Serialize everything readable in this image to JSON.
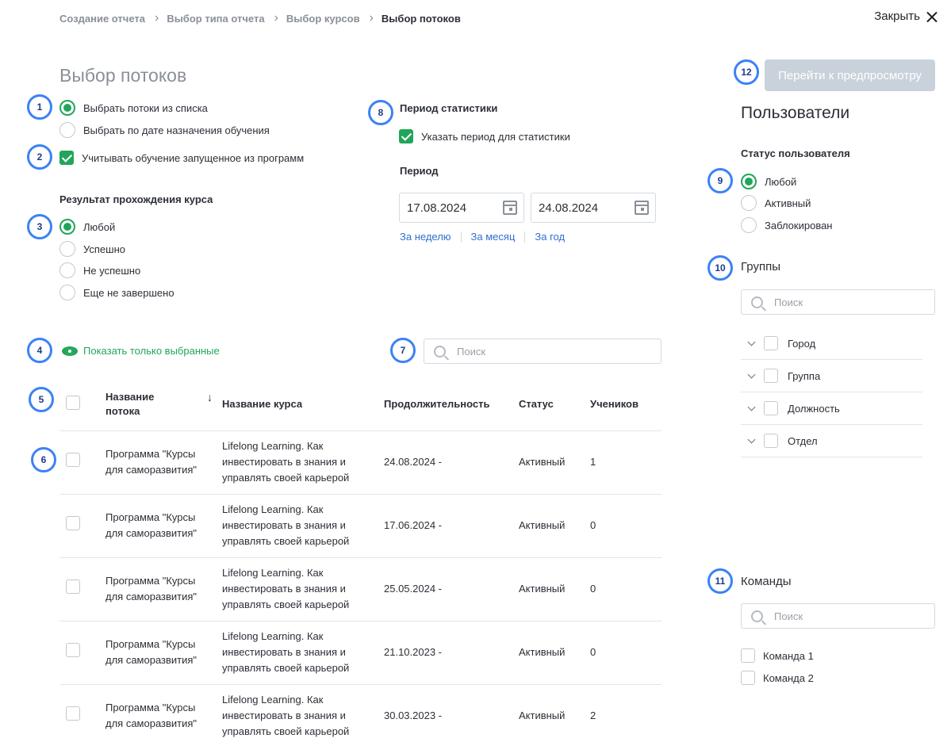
{
  "breadcrumb": {
    "items": [
      "Создание отчета",
      "Выбор типа отчета",
      "Выбор курсов"
    ],
    "current": "Выбор потоков"
  },
  "close_label": "Закрыть",
  "page_title": "Выбор потоков",
  "markers": [
    "1",
    "2",
    "3",
    "4",
    "5",
    "6",
    "7",
    "8",
    "9",
    "10",
    "11",
    "12"
  ],
  "selection_mode": {
    "options": [
      "Выбрать потоки из списка",
      "Выбрать по дате назначения обучения"
    ],
    "selected": 0
  },
  "include_programs": {
    "label": "Учитывать обучение запущенное из программ",
    "checked": true
  },
  "course_result": {
    "label": "Результат прохождения курса",
    "options": [
      "Любой",
      "Успешно",
      "Не успешно",
      "Еще не завершено"
    ],
    "selected": 0
  },
  "stats_period": {
    "label": "Период статистики",
    "toggle_label": "Указать период для статистики",
    "toggle_checked": true,
    "period_label": "Период",
    "date_from": "17.08.2024",
    "date_to": "24.08.2024",
    "quick": [
      "За неделю",
      "За месяц",
      "За год"
    ]
  },
  "show_selected_label": "Показать только выбранные",
  "search": {
    "placeholder": "Поиск"
  },
  "table": {
    "headers": [
      "Название потока",
      "Название курса",
      "Продолжительность",
      "Статус",
      "Учеников"
    ],
    "rows": [
      {
        "name": "Программа \"Курсы для саморазвития\"",
        "course": "Lifelong Learning. Как инвестировать в знания и управлять своей карьерой",
        "duration": "24.08.2024 -",
        "status": "Активный",
        "students": "1"
      },
      {
        "name": "Программа \"Курсы для саморазвития\"",
        "course": "Lifelong Learning. Как инвестировать в знания и управлять своей карьерой",
        "duration": "17.06.2024 -",
        "status": "Активный",
        "students": "0"
      },
      {
        "name": "Программа \"Курсы для саморазвития\"",
        "course": "Lifelong Learning. Как инвестировать в знания и управлять своей карьерой",
        "duration": "25.05.2024 -",
        "status": "Активный",
        "students": "0"
      },
      {
        "name": "Программа \"Курсы для саморазвития\"",
        "course": "Lifelong Learning. Как инвестировать в знания и управлять своей карьерой",
        "duration": "21.10.2023 -",
        "status": "Активный",
        "students": "0"
      },
      {
        "name": "Программа \"Курсы для саморазвития\"",
        "course": "Lifelong Learning. Как инвестировать в знания и управлять своей карьерой",
        "duration": "30.03.2023 -",
        "status": "Активный",
        "students": "2"
      }
    ]
  },
  "preview_button": "Перейти к предпросмотру",
  "users": {
    "title": "Пользователи",
    "status_label": "Статус пользователя",
    "status_options": [
      "Любой",
      "Активный",
      "Заблокирован"
    ],
    "status_selected": 0,
    "groups_label": "Группы",
    "groups_search_placeholder": "Поиск",
    "groups": [
      "Город",
      "Группа",
      "Должность",
      "Отдел"
    ],
    "teams_label": "Команды",
    "teams_search_placeholder": "Поиск",
    "teams": [
      "Команда 1",
      "Команда 2"
    ]
  },
  "colors": {
    "accent_green": "#22a55a",
    "marker_blue": "#3b82f6",
    "link_blue": "#2f6fd1",
    "button_disabled": "#c9d2db"
  }
}
